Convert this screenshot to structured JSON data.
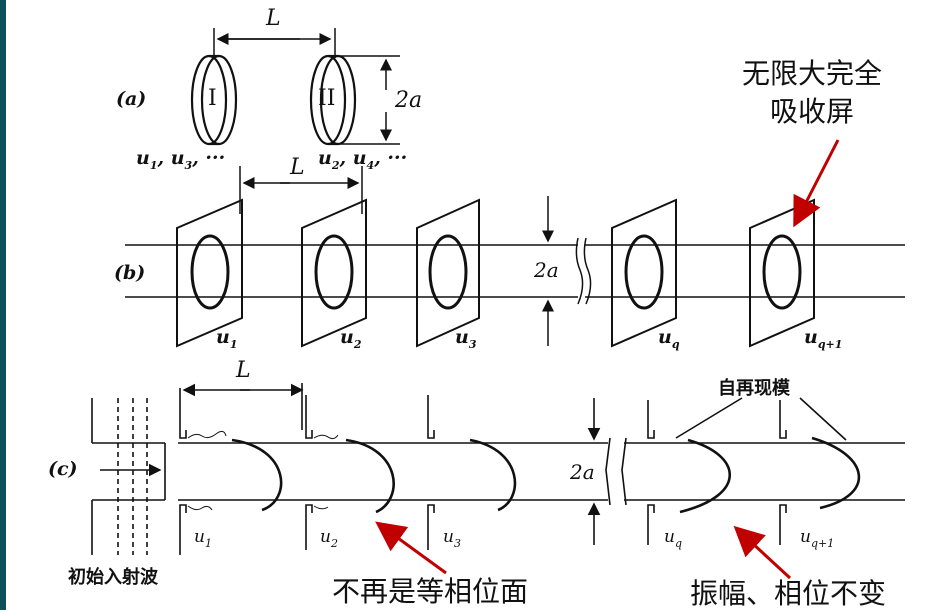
{
  "panels": {
    "a": {
      "tag": "(a)",
      "distance": "L",
      "diameter": "2a",
      "mirror1": "I",
      "mirror2": "II",
      "label1": "u",
      "label1_rest": ", u",
      "label1_sub1": "1",
      "label1_sub2": "3",
      "label1_tail": ", ···",
      "label2_sub1": "2",
      "label2_sub2": "4"
    },
    "b": {
      "tag": "(b)",
      "distance": "L",
      "diameter": "2a",
      "apertures": [
        {
          "base": "u",
          "sub": "1"
        },
        {
          "base": "u",
          "sub": "2"
        },
        {
          "base": "u",
          "sub": "3"
        },
        {
          "base": "u",
          "sub": "q"
        },
        {
          "base": "u",
          "sub": "q+1"
        }
      ]
    },
    "c": {
      "tag": "(c)",
      "distance": "L",
      "diameter": "2a",
      "apertures": [
        {
          "base": "u",
          "sub": "1"
        },
        {
          "base": "u",
          "sub": "2"
        },
        {
          "base": "u",
          "sub": "3"
        },
        {
          "base": "u",
          "sub": "q"
        },
        {
          "base": "u",
          "sub": "q+1"
        }
      ],
      "incident_wave": "初始入射波",
      "reproduced_mode": "自再现模"
    }
  },
  "annotations": {
    "absorber": [
      "无限大完全",
      "吸收屏"
    ],
    "non_equiphase": "不再是等相位面",
    "amp_phase_constant": "振幅、相位不变"
  },
  "colors": {
    "arrow": "#c00000",
    "ink": "#111111",
    "accent_bar": "#0d4f5a"
  }
}
